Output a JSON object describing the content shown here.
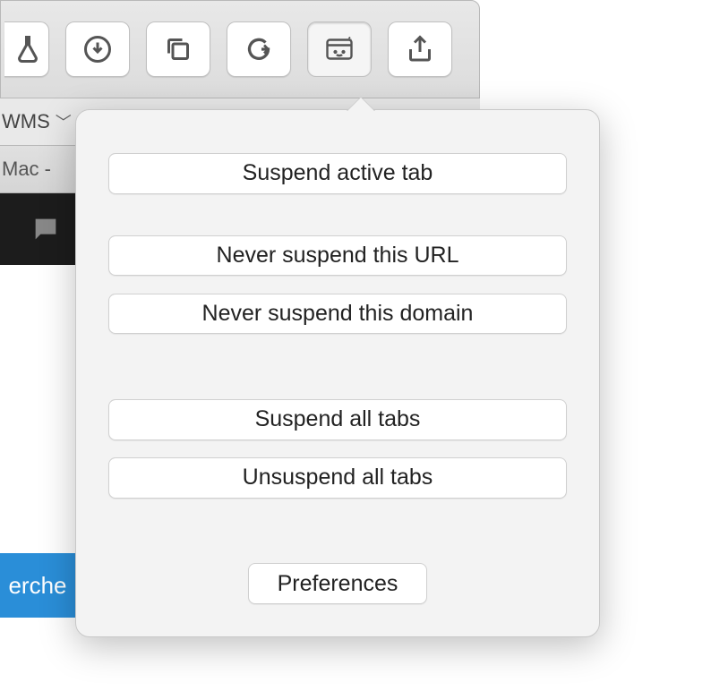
{
  "toolbar": {
    "icons": [
      "flask-icon",
      "download-icon",
      "copy-icon",
      "grammarly-icon",
      "suspender-icon",
      "share-icon"
    ]
  },
  "bookmarks": {
    "item_label": "WMS"
  },
  "tabstrip": {
    "active_tab_label": "Mac -"
  },
  "search_button_fragment": "erche",
  "popover": {
    "suspend_active": "Suspend active tab",
    "never_url": "Never suspend this URL",
    "never_domain": "Never suspend this domain",
    "suspend_all": "Suspend all tabs",
    "unsuspend_all": "Unsuspend all tabs",
    "preferences": "Preferences"
  }
}
